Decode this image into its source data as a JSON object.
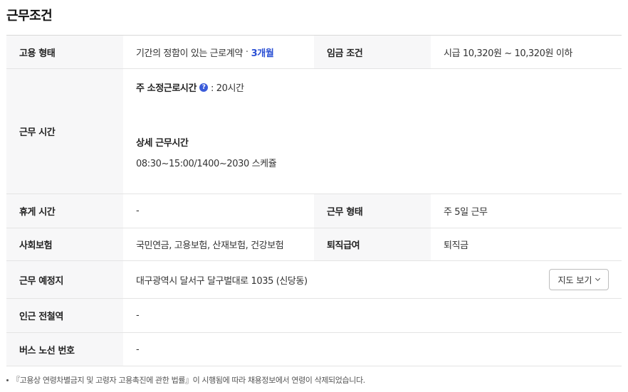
{
  "section_title": "근무조건",
  "employment": {
    "label": "고용 형태",
    "value": "기간의 정함이 있는 근로계약",
    "separator": "·",
    "duration": "3개월"
  },
  "wage": {
    "label": "임금 조건",
    "value": "시급 10,320원 ~ 10,320원 이하"
  },
  "work_hours": {
    "label": "근무 시간",
    "weekly_label": "주 소정근로시간",
    "help_icon_glyph": "?",
    "weekly_value": ": 20시간",
    "detail_label": "상세 근무시간",
    "detail_value": "08:30~15:00/1400~2030 스케쥴"
  },
  "break_time": {
    "label": "휴게 시간",
    "value": "-"
  },
  "work_type": {
    "label": "근무 형태",
    "value": "주 5일 근무"
  },
  "insurance": {
    "label": "사회보험",
    "value": "국민연금, 고용보험, 산재보험, 건강보험"
  },
  "severance": {
    "label": "퇴직급여",
    "value": "퇴직금"
  },
  "location": {
    "label": "근무 예정지",
    "value": "대구광역시 달서구 달구벌대로 1035 (신당동)",
    "map_button_label": "지도 보기"
  },
  "subway": {
    "label": "인근 전철역",
    "value": "-"
  },
  "bus": {
    "label": "버스 노선 번호",
    "value": "-"
  },
  "notice": "『고용상 연령차별금지 및 고령자 고용촉진에 관한 법률』이 시행됨에 따라 채용정보에서 연령이 삭제되었습니다.",
  "colors": {
    "accent": "#2a4fd4",
    "header_bg": "#f7f7f8",
    "border": "#e4e4e4"
  }
}
